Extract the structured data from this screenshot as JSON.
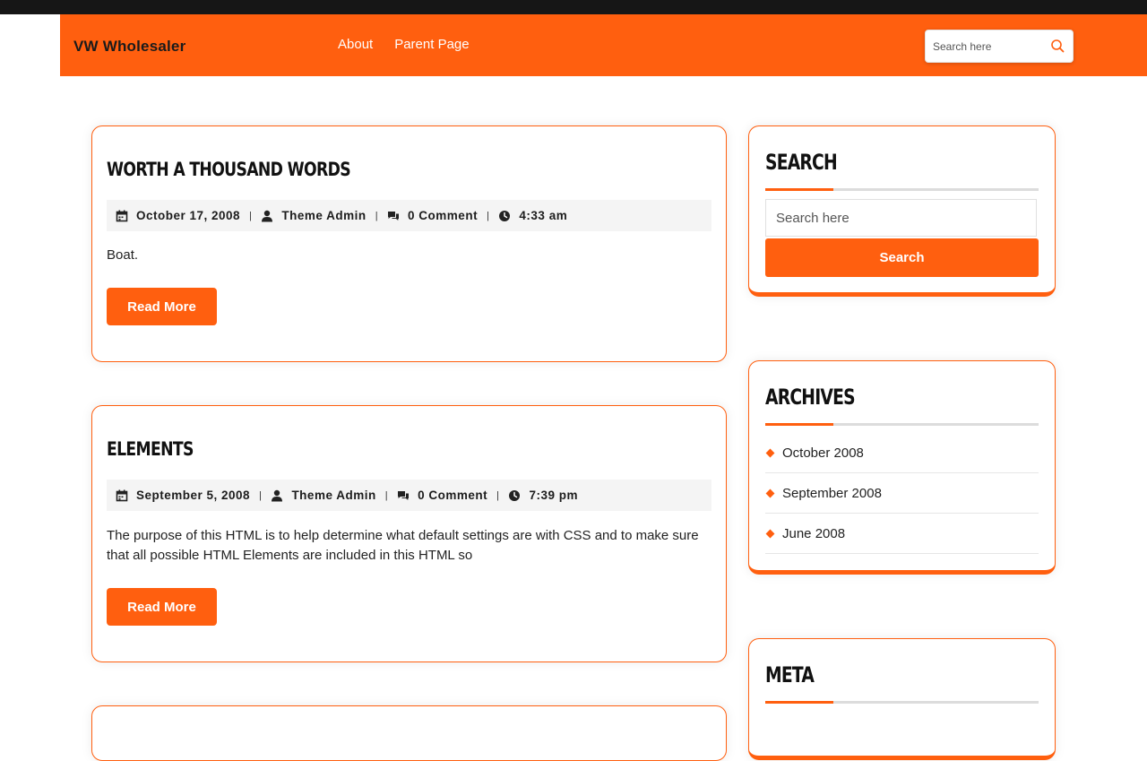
{
  "header": {
    "site_title": "VW Wholesaler",
    "nav": [
      {
        "label": "About"
      },
      {
        "label": "Parent Page"
      }
    ],
    "search_placeholder": "Search here"
  },
  "posts": [
    {
      "title": "Worth A Thousand Words",
      "date": "October 17, 2008",
      "author": "Theme Admin",
      "comments": "0 Comment",
      "time": "4:33 am",
      "excerpt": "Boat.",
      "read_more": "Read More"
    },
    {
      "title": "Elements",
      "date": "September 5, 2008",
      "author": "Theme Admin",
      "comments": "0 Comment",
      "time": "7:39 pm",
      "excerpt": "The purpose of this HTML is to help determine what default settings are with CSS and to make sure that all possible HTML Elements are included in this HTML so",
      "read_more": "Read More"
    }
  ],
  "sidebar": {
    "search": {
      "title": "Search",
      "placeholder": "Search here",
      "button": "Search"
    },
    "archives": {
      "title": "Archives",
      "items": [
        "October 2008",
        "September 2008",
        "June 2008"
      ]
    },
    "meta": {
      "title": "Meta"
    }
  },
  "colors": {
    "accent": "#ff5f0f",
    "topbar": "#161616"
  }
}
